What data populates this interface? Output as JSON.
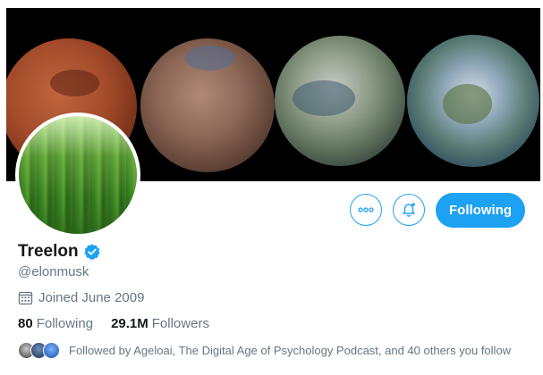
{
  "banner": {
    "description_icon": "planets-banner"
  },
  "profile": {
    "name": "Treelon",
    "handle": "@elonmusk",
    "joined": "Joined June 2009",
    "verified_icon": "verified-badge-icon"
  },
  "actions": {
    "more_icon": "more-icon",
    "notify_icon": "notification-bell-icon",
    "follow_label": "Following"
  },
  "stats": {
    "following_count": "80",
    "following_label": "Following",
    "followers_count": "29.1M",
    "followers_label": "Followers"
  },
  "followed_by": "Followed by Ageloai, The Digital Age of Psychology Podcast, and 40 others you follow",
  "colors": {
    "accent": "#1da1f2",
    "muted": "#657786",
    "text": "#14171a"
  }
}
